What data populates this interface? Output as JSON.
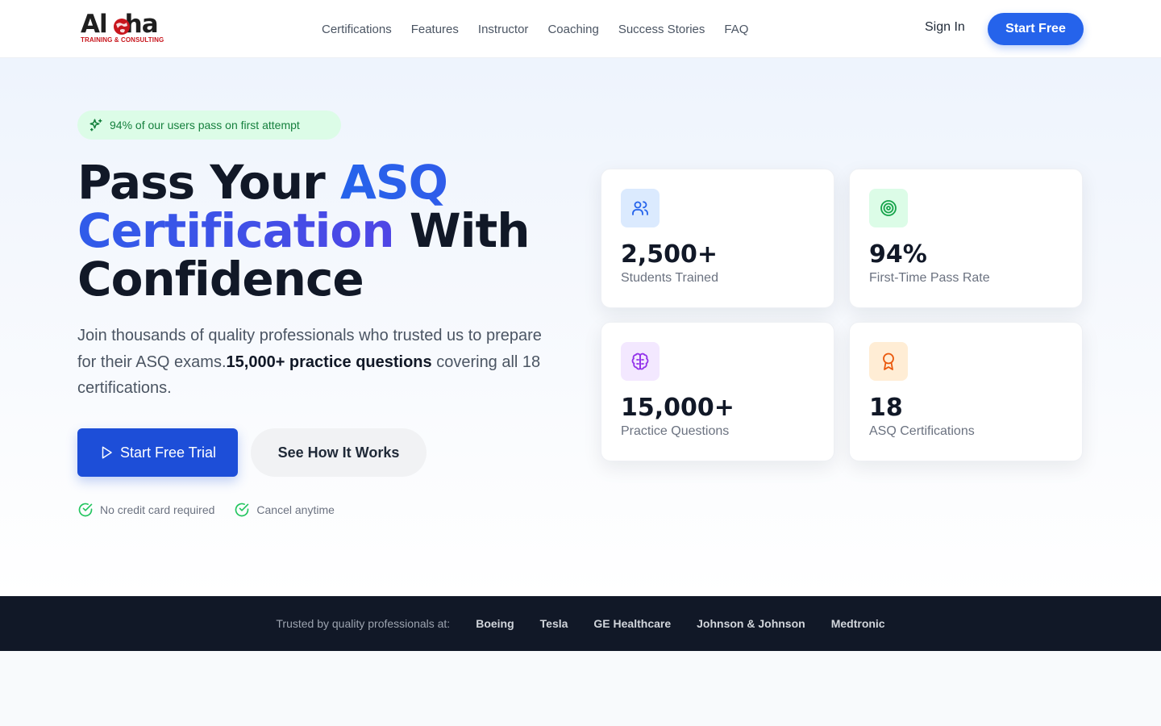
{
  "brand": {
    "name_prefix": "Al",
    "name_suffix": "ha",
    "tagline": "TRAINING & CONSULTING",
    "colors": {
      "red": "#c8161d",
      "dark": "#1f1f1f"
    }
  },
  "nav": {
    "items": [
      {
        "label": "Certifications"
      },
      {
        "label": "Features"
      },
      {
        "label": "Instructor"
      },
      {
        "label": "Coaching"
      },
      {
        "label": "Success Stories"
      },
      {
        "label": "FAQ"
      }
    ],
    "sign_in": "Sign In",
    "start_free": "Start Free"
  },
  "hero": {
    "badge": {
      "icon": "sparkles-icon",
      "text": "94% of our users pass on first attempt"
    },
    "headline": {
      "part1": "Pass Your ",
      "accent": "ASQ Certification",
      "part2": " With Confidence"
    },
    "subtext": {
      "before": "Join thousands of quality professionals who trusted us to prepare for their ASQ exams.",
      "bold": "15,000+ practice questions",
      "after": " covering all 18 certifications."
    },
    "primary_button": {
      "icon": "play-icon",
      "label": "Start Free Trial"
    },
    "secondary_button": {
      "label": "See How It Works"
    },
    "assurances": [
      {
        "icon": "check-circle-icon",
        "text": "No credit card required"
      },
      {
        "icon": "check-circle-icon",
        "text": "Cancel anytime"
      }
    ],
    "accent_color": "#2563eb"
  },
  "stats": [
    {
      "icon": "users-icon",
      "value": "2,500+",
      "label": "Students Trained",
      "icon_bg": "#dbeafe",
      "icon_color": "#2563eb"
    },
    {
      "icon": "target-icon",
      "value": "94%",
      "label": "First-Time Pass Rate",
      "icon_bg": "#dcfce7",
      "icon_color": "#16a34a"
    },
    {
      "icon": "brain-icon",
      "value": "15,000+",
      "label": "Practice Questions",
      "icon_bg": "#f3e8ff",
      "icon_color": "#9333ea"
    },
    {
      "icon": "award-icon",
      "value": "18",
      "label": "ASQ Certifications",
      "icon_bg": "#ffedd5",
      "icon_color": "#ea580c"
    }
  ],
  "trusted": {
    "label": "Trusted by quality professionals at:",
    "companies": [
      "Boeing",
      "Tesla",
      "GE Healthcare",
      "Johnson & Johnson",
      "Medtronic"
    ]
  }
}
